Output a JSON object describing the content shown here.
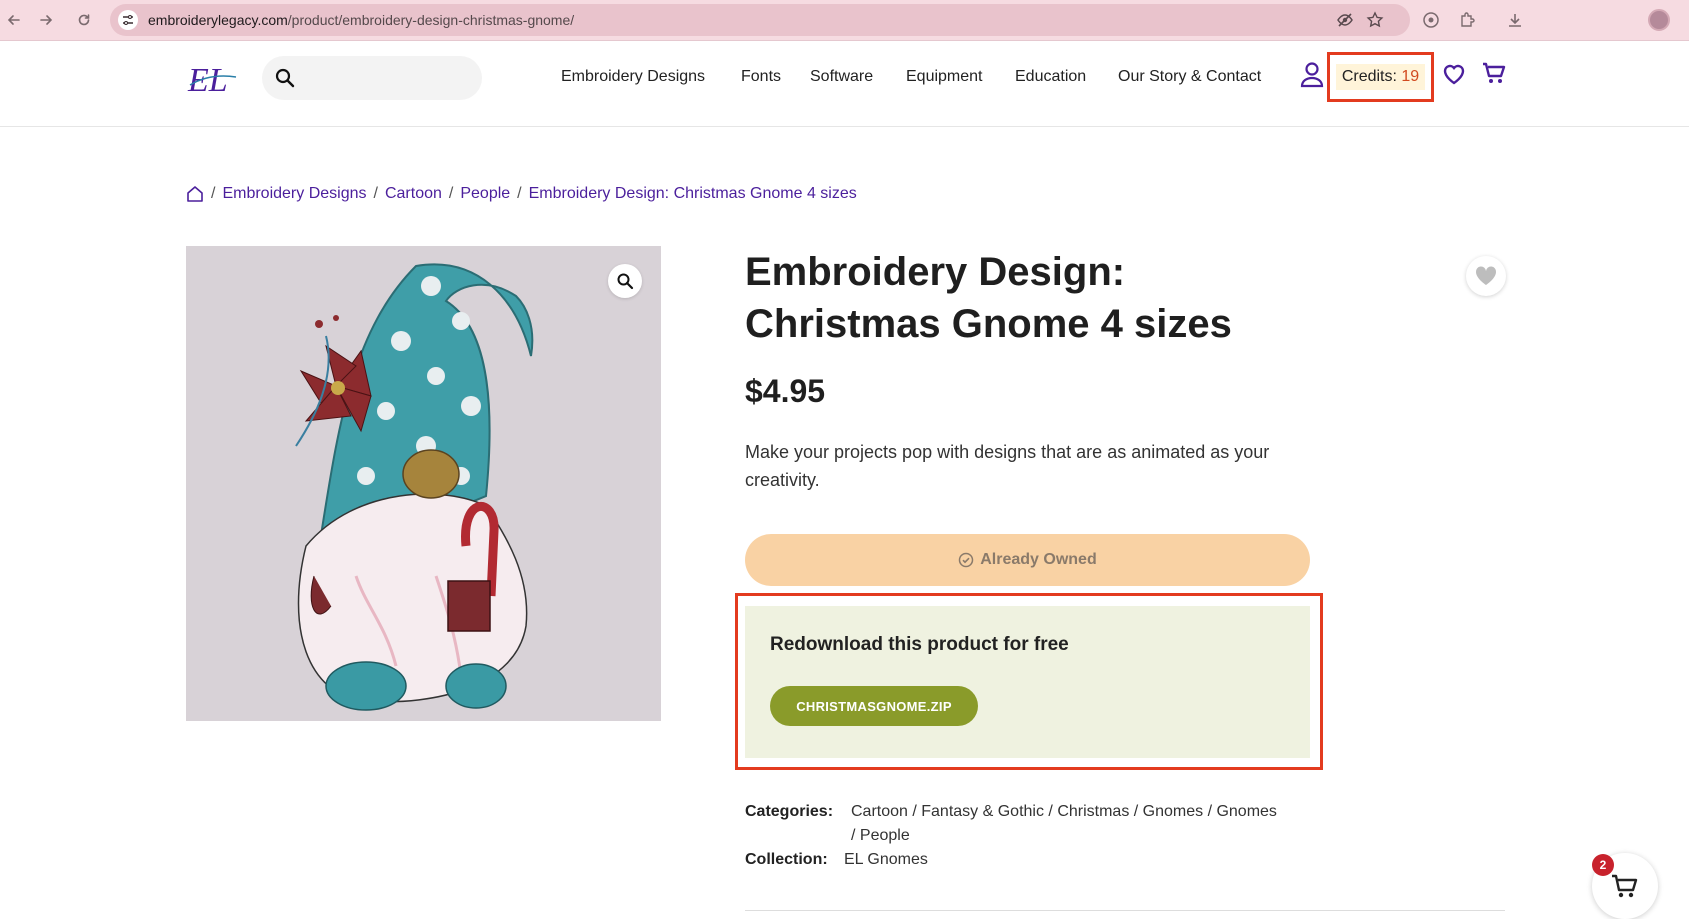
{
  "browser": {
    "url_host": "embroiderylegacy.com",
    "url_path": "/product/embroidery-design-christmas-gnome/",
    "icons": [
      "back-icon",
      "forward-icon",
      "reload-icon",
      "site-settings-icon",
      "eye-off-icon",
      "star-icon",
      "google-lens-icon",
      "extensions-icon",
      "download-icon",
      "profile-avatar"
    ]
  },
  "header": {
    "logo_text": "EL",
    "search": {
      "placeholder": ""
    },
    "nav": [
      {
        "label": "Embroidery Designs"
      },
      {
        "label": "Fonts"
      },
      {
        "label": "Software"
      },
      {
        "label": "Equipment"
      },
      {
        "label": "Education"
      },
      {
        "label": "Our Story & Contact"
      }
    ],
    "credits_label": "Credits: ",
    "credits_value": "19"
  },
  "breadcrumb": {
    "items": [
      "Embroidery Designs",
      "Cartoon",
      "People",
      "Embroidery Design: Christmas Gnome 4 sizes"
    ],
    "separator": "/"
  },
  "product": {
    "title_line1": "Embroidery Design:",
    "title_line2": "Christmas Gnome 4 sizes",
    "price": "$4.95",
    "description": "Make your projects pop with designs that are as animated as your creativity.",
    "owned_label": "Already Owned",
    "redownload_title": "Redownload this product for free",
    "download_file": "CHRISTMASGNOME.ZIP",
    "categories_label": "Categories:",
    "categories_line1": "Cartoon / Fantasy & Gothic / Christmas / Gnomes / Gnomes",
    "categories_line2": "/ People",
    "collection_label": "Collection:",
    "collection_value": "EL Gnomes"
  },
  "floating_cart": {
    "count": "2"
  },
  "colors": {
    "brand_purple": "#4b1f9c",
    "highlight_red": "#e33b1f",
    "owned_button": "#f9d2a4",
    "download_button": "#8a9b2a",
    "redownload_bg": "#eff2e0"
  }
}
